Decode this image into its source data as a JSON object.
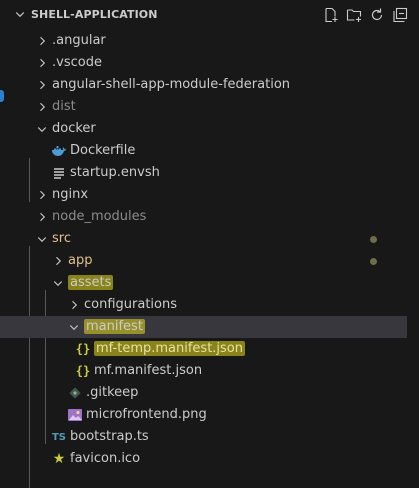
{
  "explorer": {
    "title": "SHELL-APPLICATION",
    "actions": [
      {
        "name": "new-file-icon"
      },
      {
        "name": "new-folder-icon"
      },
      {
        "name": "refresh-icon"
      },
      {
        "name": "collapse-all-icon"
      }
    ]
  },
  "tree": [
    {
      "label": ".angular",
      "type": "folder",
      "open": false,
      "depth": 1
    },
    {
      "label": ".vscode",
      "type": "folder",
      "open": false,
      "depth": 1
    },
    {
      "label": "angular-shell-app-module-federation",
      "type": "folder",
      "open": false,
      "depth": 1
    },
    {
      "label": "dist",
      "type": "folder",
      "open": false,
      "depth": 1,
      "dim": true
    },
    {
      "label": "docker",
      "type": "folder",
      "open": true,
      "depth": 1
    },
    {
      "label": "Dockerfile",
      "type": "file",
      "icon": "docker-icon",
      "depth": 2
    },
    {
      "label": "startup.envsh",
      "type": "file",
      "icon": "lines-icon",
      "depth": 2
    },
    {
      "label": "nginx",
      "type": "folder",
      "open": false,
      "depth": 1
    },
    {
      "label": "node_modules",
      "type": "folder",
      "open": false,
      "depth": 1,
      "dim": true
    },
    {
      "label": "src",
      "type": "folder",
      "open": true,
      "depth": 1,
      "modified": true
    },
    {
      "label": "app",
      "type": "folder",
      "open": false,
      "depth": 2,
      "modified": true
    },
    {
      "label": "assets",
      "type": "folder",
      "open": true,
      "depth": 2,
      "highlight": true
    },
    {
      "label": "configurations",
      "type": "folder",
      "open": false,
      "depth": 3
    },
    {
      "label": "manifest",
      "type": "folder",
      "open": true,
      "depth": 3,
      "highlight": true,
      "selected": true
    },
    {
      "label": "mf-temp.manifest.json",
      "type": "file",
      "icon": "json-icon",
      "depth": 4,
      "highlight": true
    },
    {
      "label": "mf.manifest.json",
      "type": "file",
      "icon": "json-icon",
      "depth": 4
    },
    {
      "label": ".gitkeep",
      "type": "file",
      "icon": "gitkeep-icon",
      "depth": 3
    },
    {
      "label": "microfrontend.png",
      "type": "file",
      "icon": "image-icon",
      "depth": 3
    },
    {
      "label": "bootstrap.ts",
      "type": "file",
      "icon": "ts-icon",
      "icon_text": "TS",
      "depth": 2
    },
    {
      "label": "favicon.ico",
      "type": "file",
      "icon": "star-icon",
      "icon_text": "★",
      "depth": 2
    }
  ],
  "json_icon_text": "{}",
  "colors": {
    "background": "#181818",
    "selected_row": "#37373d",
    "modified_text": "#e2c08d",
    "highlight": "#e6dc1e",
    "json_icon": "#cbcb41",
    "ts_icon": "#519aba",
    "docker_icon": "#4d9bd6"
  }
}
